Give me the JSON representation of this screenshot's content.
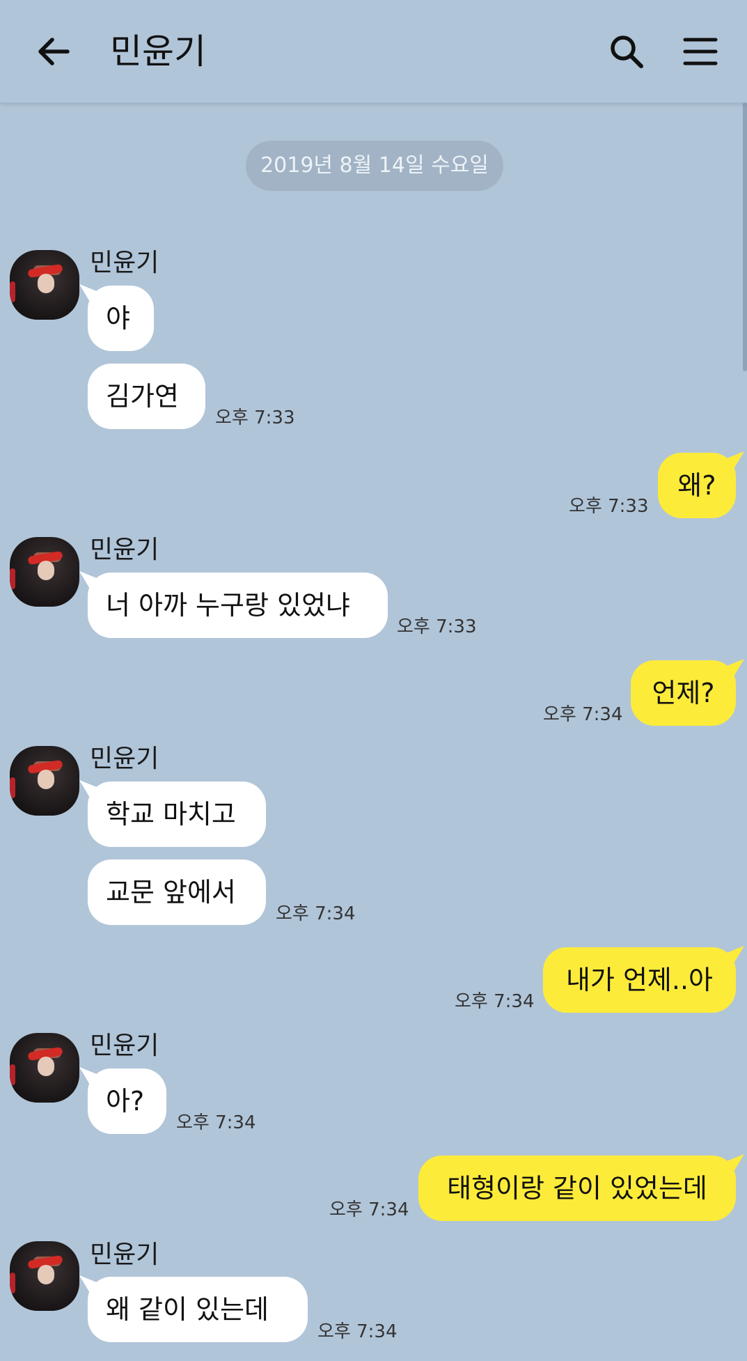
{
  "header": {
    "title": "민윤기"
  },
  "date_divider": "2019년 8월 14일 수요일",
  "messages": [
    {
      "sender": "민윤기",
      "texts": [
        "야",
        "김가연"
      ],
      "time": "오후 7:33"
    },
    {
      "text": "왜?",
      "time": "오후 7:33"
    },
    {
      "sender": "민윤기",
      "texts": [
        "너 아까 누구랑 있었냐"
      ],
      "time": "오후 7:33"
    },
    {
      "text": "언제?",
      "time": "오후 7:34"
    },
    {
      "sender": "민윤기",
      "texts": [
        "학교 마치고",
        "교문 앞에서"
      ],
      "time": "오후 7:34"
    },
    {
      "text": "내가 언제..아",
      "time": "오후 7:34"
    },
    {
      "sender": "민윤기",
      "texts": [
        "아?"
      ],
      "time": "오후 7:34"
    },
    {
      "text": "태형이랑 같이 있었는데",
      "time": "오후 7:34"
    },
    {
      "sender": "민윤기",
      "texts": [
        "왜 같이 있는데"
      ],
      "time": "오후 7:34"
    }
  ]
}
